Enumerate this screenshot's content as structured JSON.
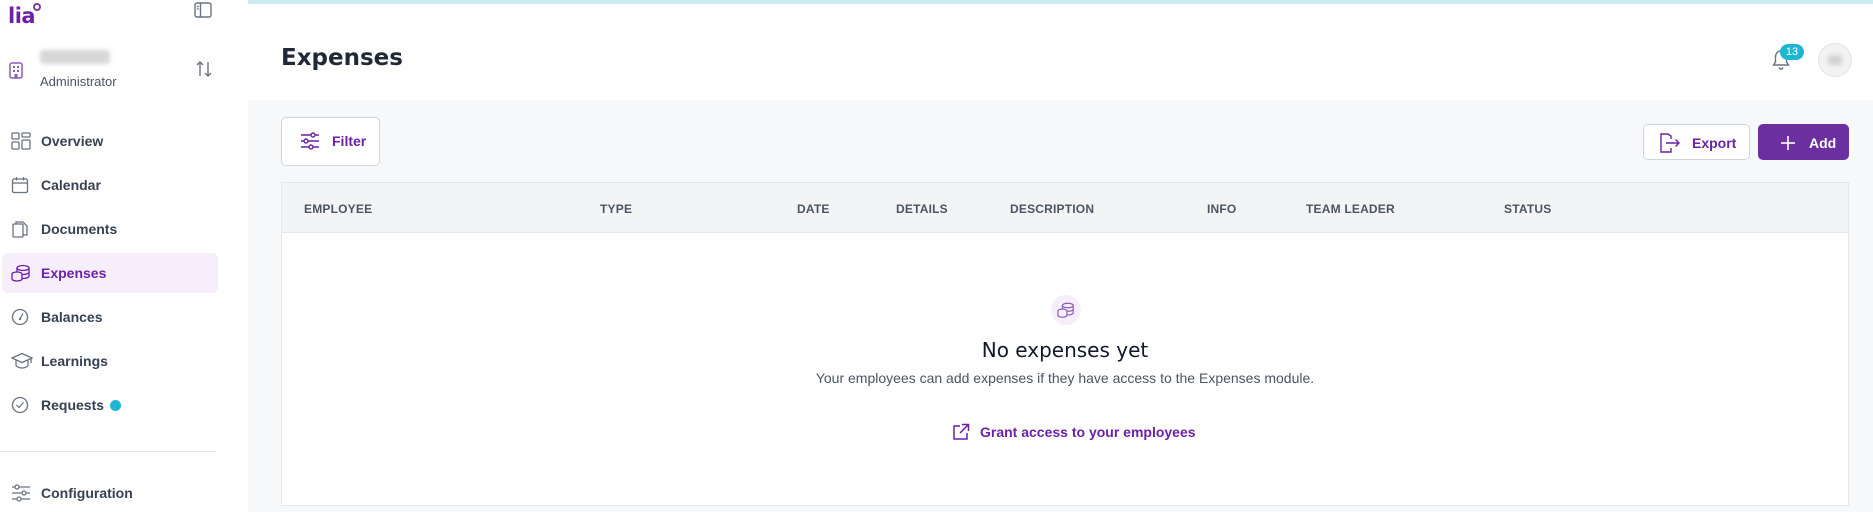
{
  "brand": {
    "logo_text": "lia"
  },
  "company": {
    "name": "",
    "role": "Administrator"
  },
  "sidebar": {
    "items": [
      {
        "label": "Overview",
        "icon": "grid-icon"
      },
      {
        "label": "Calendar",
        "icon": "calendar-icon"
      },
      {
        "label": "Documents",
        "icon": "documents-icon"
      },
      {
        "label": "Expenses",
        "icon": "coins-icon",
        "active": true
      },
      {
        "label": "Balances",
        "icon": "gauge-icon"
      },
      {
        "label": "Learnings",
        "icon": "graduation-cap-icon"
      },
      {
        "label": "Requests",
        "icon": "check-circle-icon",
        "has_dot": true
      }
    ],
    "footer_item": {
      "label": "Configuration",
      "icon": "sliders-icon"
    }
  },
  "header": {
    "title": "Expenses",
    "notifications_count": "13"
  },
  "toolbar": {
    "filter_label": "Filter",
    "export_label": "Export",
    "add_label": "Add"
  },
  "table": {
    "columns": [
      "EMPLOYEE",
      "TYPE",
      "DATE",
      "DETAILS",
      "DESCRIPTION",
      "INFO",
      "TEAM LEADER",
      "STATUS"
    ],
    "rows": []
  },
  "empty_state": {
    "title": "No expenses yet",
    "subtitle": "Your employees can add expenses if they have access to the Expenses module.",
    "link_label": "Grant access to your employees"
  },
  "colors": {
    "accent": "#6b2fa0",
    "accent_text": "#6b21a8",
    "active_bg": "#f7eefc",
    "badge": "#1fb6d6"
  }
}
